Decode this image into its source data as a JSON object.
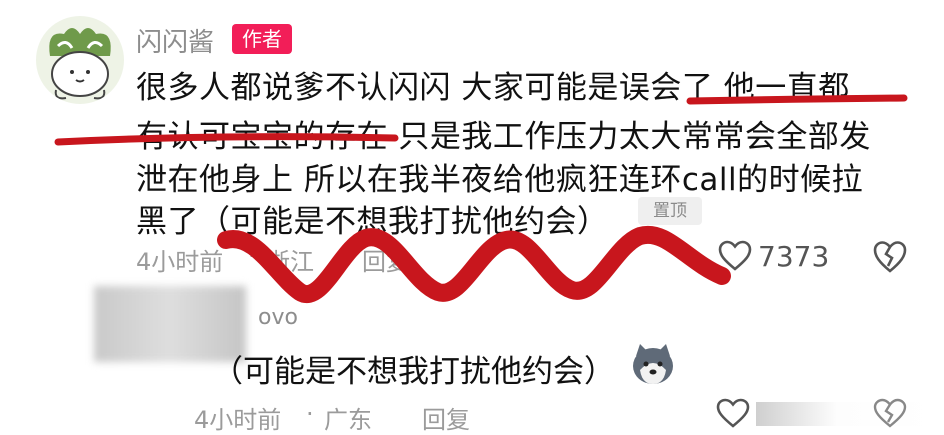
{
  "main_comment": {
    "username": "闪闪酱",
    "author_badge": "作者",
    "text_lines": [
      "很多人都说爹不认闪闪 大家可能是误会了 他一直都",
      "有认可宝宝的存在 只是我工作压力太大常常会全部发",
      "泄在他身上 所以在我半夜给他疯狂连环call的时候拉",
      "黑了（可能是不想我打扰他约会）"
    ],
    "pinned_label": "置顶",
    "time": "4小时前",
    "location": "浙江",
    "reply_label": "回复",
    "like_count": "7373",
    "like_icon": "heart-outline-icon",
    "dislike_icon": "broken-heart-icon"
  },
  "reply_comment": {
    "username": "ovo",
    "text": "（可能是不想我打扰他约会）",
    "emoji": "dog-emoji-icon",
    "time": "4小时前",
    "location": "广东",
    "reply_label": "回复",
    "like_icon": "heart-outline-icon",
    "dislike_icon": "broken-heart-icon"
  },
  "annotation_color": "#c8161d",
  "badge_color": "#f21e58"
}
